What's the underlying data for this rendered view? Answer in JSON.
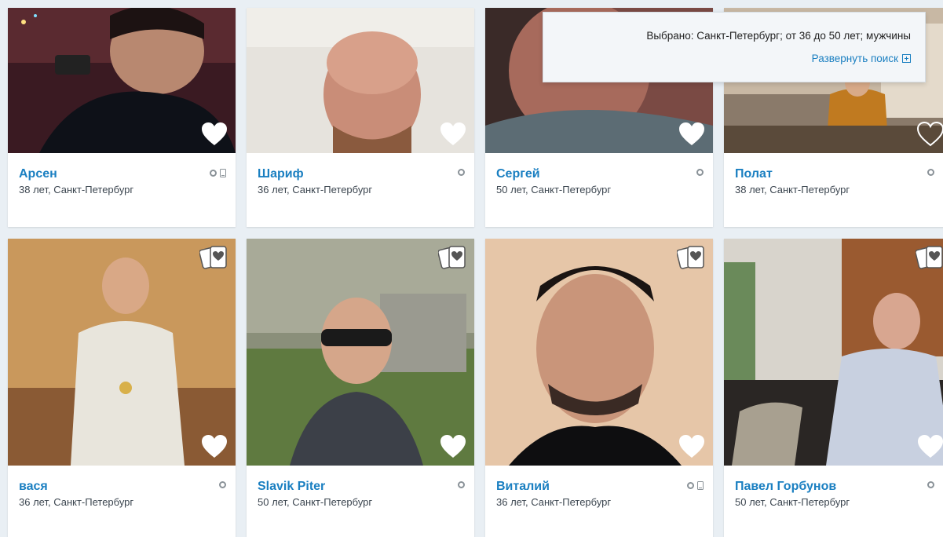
{
  "search_popup": {
    "selected_text": "Выбрано: Санкт-Петербург; от 36 до 50 лет; мужчины",
    "expand_label": "Развернуть поиск"
  },
  "profiles": [
    {
      "name": "Арсен",
      "meta": "38 лет, Санкт-Петербург",
      "mobile": true,
      "photo_icon": false
    },
    {
      "name": "Шариф",
      "meta": "36 лет, Санкт-Петербург",
      "mobile": false,
      "photo_icon": false
    },
    {
      "name": "Сергей",
      "meta": "50 лет, Санкт-Петербург",
      "mobile": false,
      "photo_icon": false
    },
    {
      "name": "Полат",
      "meta": "38 лет, Санкт-Петербург",
      "mobile": false,
      "photo_icon": false
    },
    {
      "name": "вася",
      "meta": "36 лет, Санкт-Петербург",
      "mobile": false,
      "photo_icon": true
    },
    {
      "name": "Slavik Piter",
      "meta": "50 лет, Санкт-Петербург",
      "mobile": false,
      "photo_icon": true
    },
    {
      "name": "Виталий",
      "meta": "36 лет, Санкт-Петербург",
      "mobile": true,
      "photo_icon": true
    },
    {
      "name": "Павел Горбунов",
      "meta": "50 лет, Санкт-Петербург",
      "mobile": false,
      "photo_icon": true
    }
  ],
  "colors": {
    "link": "#1a7fc1",
    "background": "#e9eff4",
    "status_icon": "#8a9298"
  }
}
